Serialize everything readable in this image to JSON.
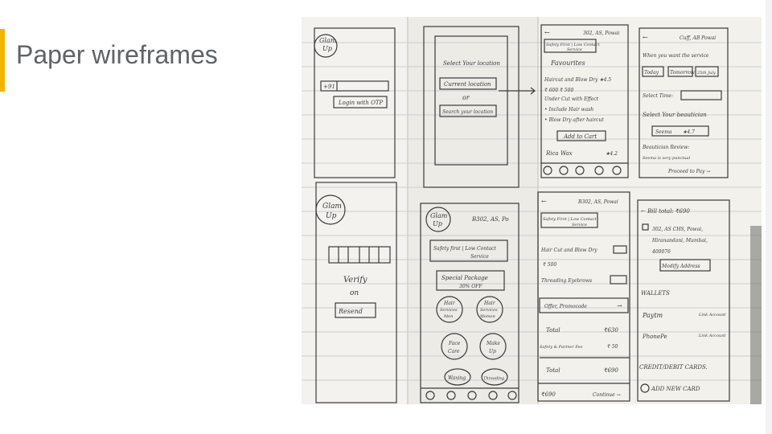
{
  "slide": {
    "title": "Paper wireframes"
  },
  "sketches": {
    "login": {
      "logo": [
        "Glam",
        "Up"
      ],
      "phone_prefix": "+91",
      "otp_button": "Login with OTP"
    },
    "location": {
      "heading": "Select Your location",
      "current": "Current location",
      "or": "or",
      "search": "Search your location"
    },
    "favourites": {
      "address": "302, AS, Powai",
      "badge": [
        "Safety First | Low Contact",
        "Service"
      ],
      "heading": "Favourites",
      "lines": [
        "Haircut and Blow Dry  ★4.5",
        "₹ 600  ₹ 500",
        "Under Cut with Effect",
        "• Include Hair wash",
        "• Blow Dry after haircut"
      ],
      "add_button": "Add to Cart",
      "rica": "Rica Wax",
      "rica_rating": "★4.2"
    },
    "booking": {
      "address": "Cuff, AB Powai",
      "question": "When you want the service",
      "days": [
        "Today",
        "Tomorrow",
        "25th July"
      ],
      "time": "Select Time:",
      "beautician_heading": "Select Your beautician",
      "beautician": "Seema",
      "rating": "★4.7",
      "reviews": "Beautician Review:",
      "review_text": "Seema is very punctual",
      "proceed": "Proceed to Pay →"
    },
    "verify": {
      "logo": [
        "Glam",
        "Up"
      ],
      "verify": "Verify",
      "on": "on",
      "resend": "Resend"
    },
    "home": {
      "logo": [
        "Glam",
        "Up"
      ],
      "address": "B302, AS, Po",
      "badge": [
        "Safety first | Low Contact",
        "Service"
      ],
      "package": [
        "Special Package",
        "30% OFF"
      ],
      "categories": [
        [
          "Hair",
          "Services",
          "Men"
        ],
        [
          "Hair",
          "Services",
          "Women"
        ],
        [
          "Face",
          "Care"
        ],
        [
          "Make",
          "Up"
        ],
        [
          "Waxing"
        ],
        [
          "Threading"
        ]
      ]
    },
    "cart": {
      "address": "B302, AS, Powai",
      "badge": [
        "Safety First | Low Contact",
        "Service"
      ],
      "item1": "Hair Cut and Blow Dry",
      "item1_price": "₹ 500",
      "item2": "Threading Eyebrows",
      "offer": "Offer, Promocode",
      "total_label": "Total",
      "total_value": "₹630",
      "fee_label": "Safety & Partner Fee",
      "fee_value": "₹ 50",
      "grand_label": "Total",
      "grand_value": "₹690",
      "footer_amount": "₹690",
      "continue": "Continue →"
    },
    "payment": {
      "bill": "← Bill total: ₹690",
      "address_lines": [
        "302, AS CHS, Powai,",
        "Hiranandani, Mumbai,",
        "400076"
      ],
      "modify": "Modify Address",
      "wallets": "WALLETS",
      "paytm": "Paytm",
      "phonepe": "PhonePe",
      "link": "Link Account",
      "cards": "CREDIT/DEBIT CARDS.",
      "add_card": "ADD NEW CARD"
    }
  }
}
